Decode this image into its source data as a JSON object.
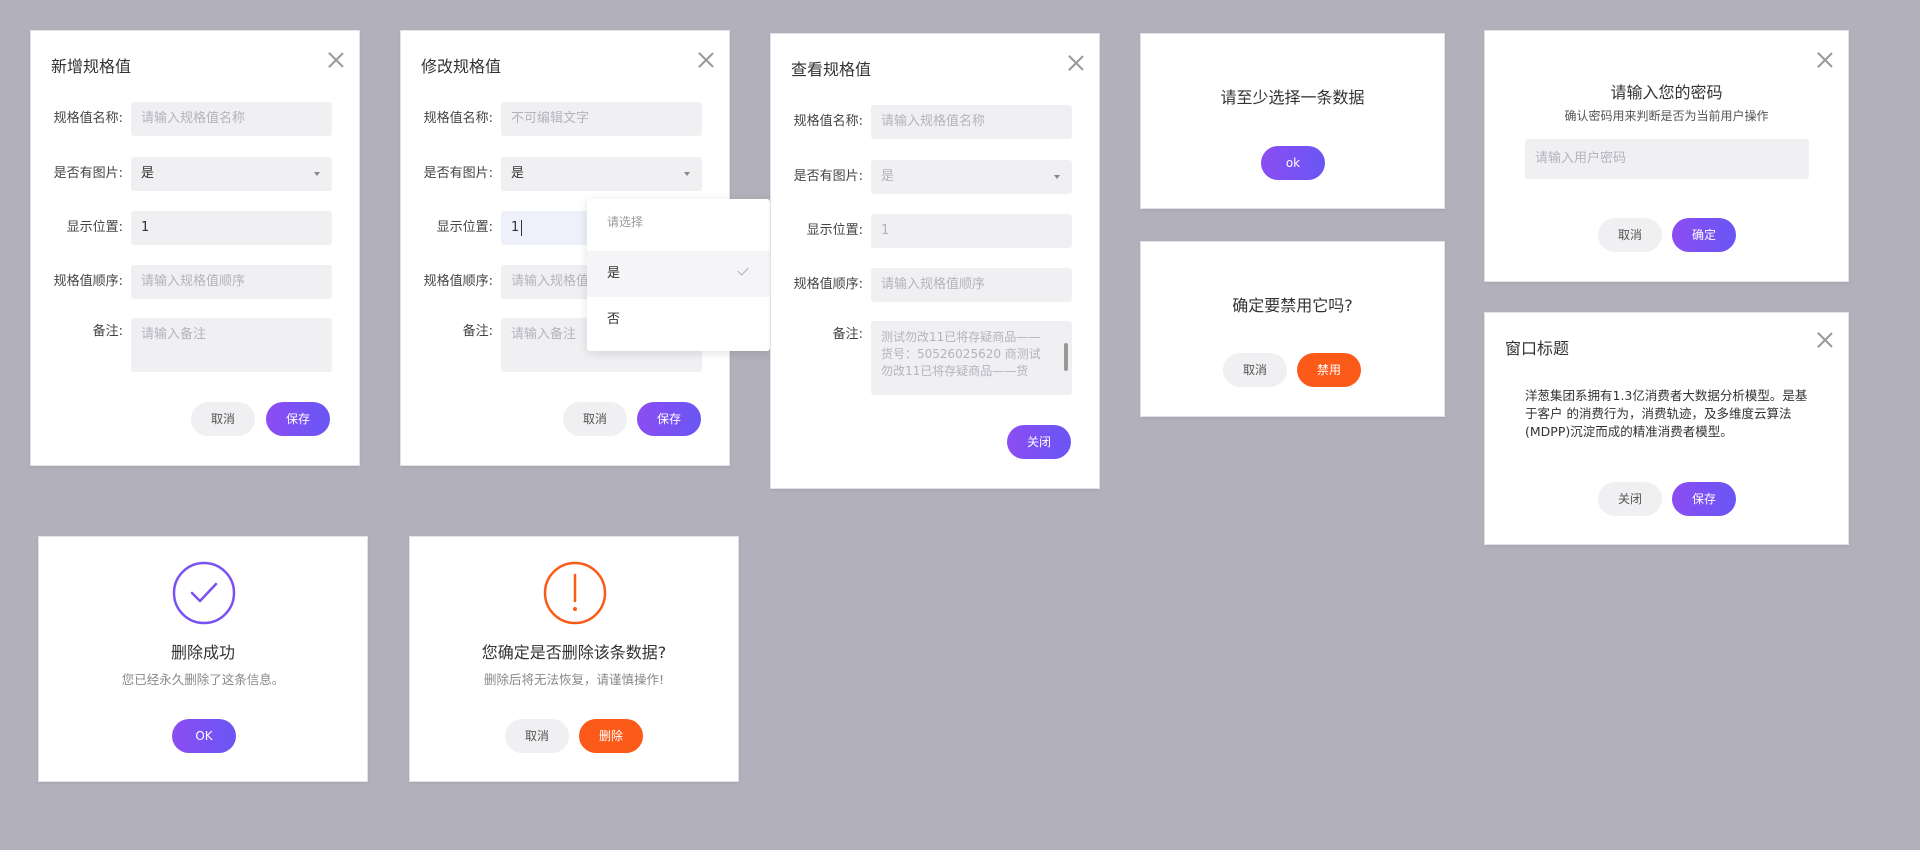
{
  "colors": {
    "purple": "#7a52f3",
    "orange": "#fb5a19",
    "grey_btn": "#f0f0f2",
    "bg": "#b2b1bb"
  },
  "add_dialog": {
    "title": "新增规格值",
    "name_label": "规格值名称:",
    "name_placeholder": "请输入规格值名称",
    "image_label": "是否有图片:",
    "image_value": "是",
    "pos_label": "显示位置:",
    "pos_value": "1",
    "order_label": "规格值顺序:",
    "order_placeholder": "请输入规格值顺序",
    "note_label": "备注:",
    "note_placeholder": "请输入备注",
    "cancel": "取消",
    "save": "保存"
  },
  "edit_dialog": {
    "title": "修改规格值",
    "name_label": "规格值名称:",
    "name_value": "不可编辑文字",
    "image_label": "是否有图片:",
    "image_value": "是",
    "pos_label": "显示位置:",
    "pos_value": "1",
    "order_label": "规格值顺序:",
    "order_placeholder": "请输入规格值顺序",
    "note_label": "备注:",
    "note_placeholder": "请输入备注",
    "cancel": "取消",
    "save": "保存",
    "dropdown": {
      "hint": "请选择",
      "options": [
        "是",
        "否"
      ],
      "selected": "是"
    }
  },
  "view_dialog": {
    "title": "查看规格值",
    "name_label": "规格值名称:",
    "name_placeholder": "请输入规格值名称",
    "image_label": "是否有图片:",
    "image_value": "是",
    "pos_label": "显示位置:",
    "pos_value": "1",
    "order_label": "规格值顺序:",
    "order_placeholder": "请输入规格值顺序",
    "note_label": "备注:",
    "note_value": "测试勿改11已将存疑商品——货号：50526025620 商测试勿改11已将存疑商品——货",
    "close": "关闭"
  },
  "select_alert": {
    "message": "请至少选择一条数据",
    "ok": "ok"
  },
  "disable_confirm": {
    "message": "确定要禁用它吗?",
    "cancel": "取消",
    "disable": "禁用"
  },
  "password_dialog": {
    "title": "请输入您的密码",
    "subtitle": "确认密码用来判断是否为当前用户操作",
    "placeholder": "请输入用户密码",
    "cancel": "取消",
    "confirm": "确定"
  },
  "window_dialog": {
    "title": "窗口标题",
    "body": "洋葱集团系拥有1.3亿消费者大数据分析模型。是基于客户 的消费行为，消费轨迹，及多维度云算法(MDPP)沉淀而成的精准消费者模型。",
    "close": "关闭",
    "save": "保存"
  },
  "delete_success": {
    "title": "删除成功",
    "subtitle": "您已经永久删除了这条信息。",
    "ok": "OK"
  },
  "delete_confirm": {
    "title": "您确定是否删除该条数据?",
    "subtitle": "删除后将无法恢复，请谨慎操作!",
    "cancel": "取消",
    "delete": "删除"
  }
}
